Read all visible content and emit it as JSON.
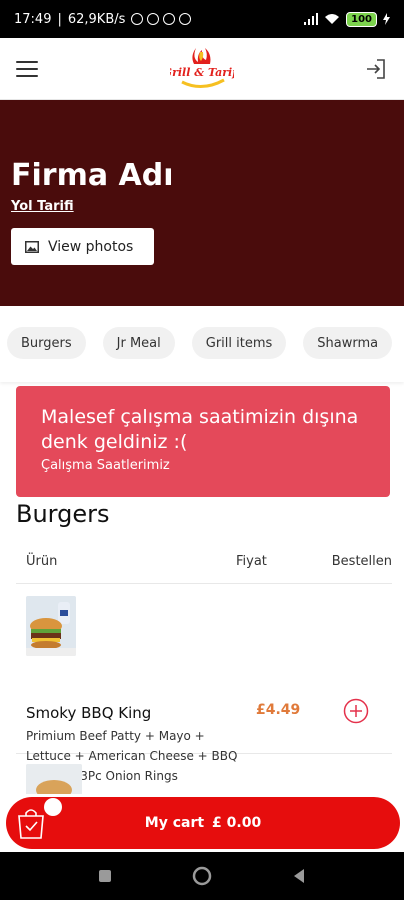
{
  "status_bar": {
    "time": "17:49",
    "net_speed": "62,9KB/s",
    "battery": "100"
  },
  "header": {
    "logo_text": "Grill & Tariff"
  },
  "hero": {
    "title": "Firma Adı",
    "directions_label": "Yol Tarifi",
    "view_photos_label": "View photos"
  },
  "categories": [
    {
      "label": "Burgers"
    },
    {
      "label": "Jr Meal"
    },
    {
      "label": "Grill items"
    },
    {
      "label": "Shawrma"
    }
  ],
  "alert": {
    "title": "Malesef çalışma saatimizin dışına denk geldiniz :(",
    "link": "Çalışma Saatlerimiz"
  },
  "section": {
    "title": "Burgers"
  },
  "table": {
    "headers": {
      "product": "Ürün",
      "price": "Fiyat",
      "order": "Bestellen"
    },
    "items": [
      {
        "name": "Smoky BBQ King",
        "description": "Primium Beef Patty + Mayo + Lettuce + American Cheese + BBQ Sauce + 3Pc Onion Rings",
        "price": "£4.49"
      }
    ]
  },
  "cart": {
    "label": "My cart",
    "total": "£ 0.00"
  },
  "colors": {
    "hero_bg": "#4a0c0c",
    "alert_bg": "#e4495a",
    "cart_bg": "#e60d0d",
    "price": "#e07a3a"
  }
}
